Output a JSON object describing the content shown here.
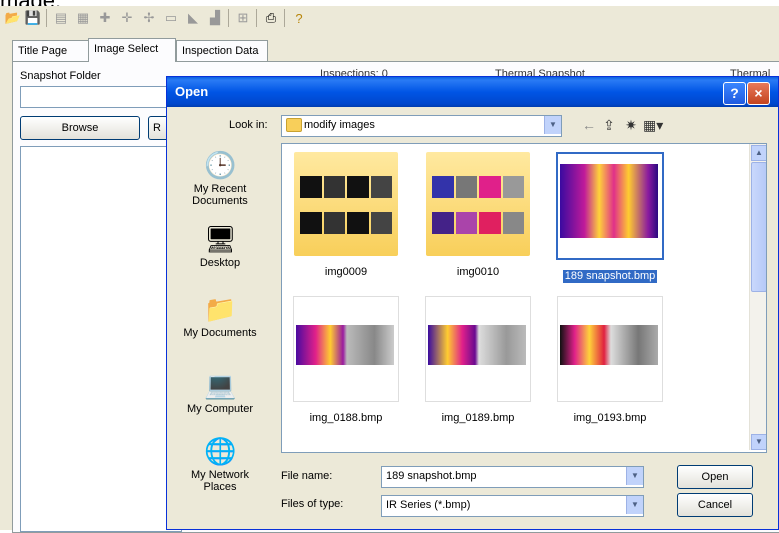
{
  "top_fragment": "mage.",
  "app": {
    "tabs": [
      "Title Page",
      "Image Select",
      "Inspection Data"
    ],
    "active_tab": "Image Select",
    "snapshot_folder_label": "Snapshot Folder",
    "browse_label": "Browse",
    "r_button_label": "R",
    "inspections_header": "Inspections: 0",
    "thermal_snapshot_header": "Thermal Snapshot",
    "thermal_header_2": "Thermal a"
  },
  "dialog": {
    "title": "Open",
    "help_glyph": "?",
    "close_glyph": "×",
    "look_in_label": "Look in:",
    "look_in_value": "modify images",
    "places": [
      {
        "label": "My Recent Documents",
        "icon": "recent-documents-icon"
      },
      {
        "label": "Desktop",
        "icon": "desktop-icon"
      },
      {
        "label": "My Documents",
        "icon": "my-documents-icon"
      },
      {
        "label": "My Computer",
        "icon": "my-computer-icon"
      },
      {
        "label": "My Network Places",
        "icon": "network-places-icon"
      }
    ],
    "files": [
      {
        "name": "img0009",
        "kind": "folder",
        "selected": false
      },
      {
        "name": "img0010",
        "kind": "folder",
        "selected": false
      },
      {
        "name": "189 snapshot.bmp",
        "kind": "bmp",
        "selected": true
      },
      {
        "name": "img_0188.bmp",
        "kind": "bmp",
        "selected": false
      },
      {
        "name": "img_0189.bmp",
        "kind": "bmp",
        "selected": false
      },
      {
        "name": "img_0193.bmp",
        "kind": "bmp",
        "selected": false
      }
    ],
    "file_name_label": "File name:",
    "file_name_value": "189 snapshot.bmp",
    "files_of_type_label": "Files of type:",
    "files_of_type_value": "IR Series (*.bmp)",
    "open_label": "Open",
    "cancel_label": "Cancel"
  },
  "colors": {
    "titlebar": "#0055e5",
    "selection": "#316ac5",
    "folder": "#f8cf5a"
  }
}
